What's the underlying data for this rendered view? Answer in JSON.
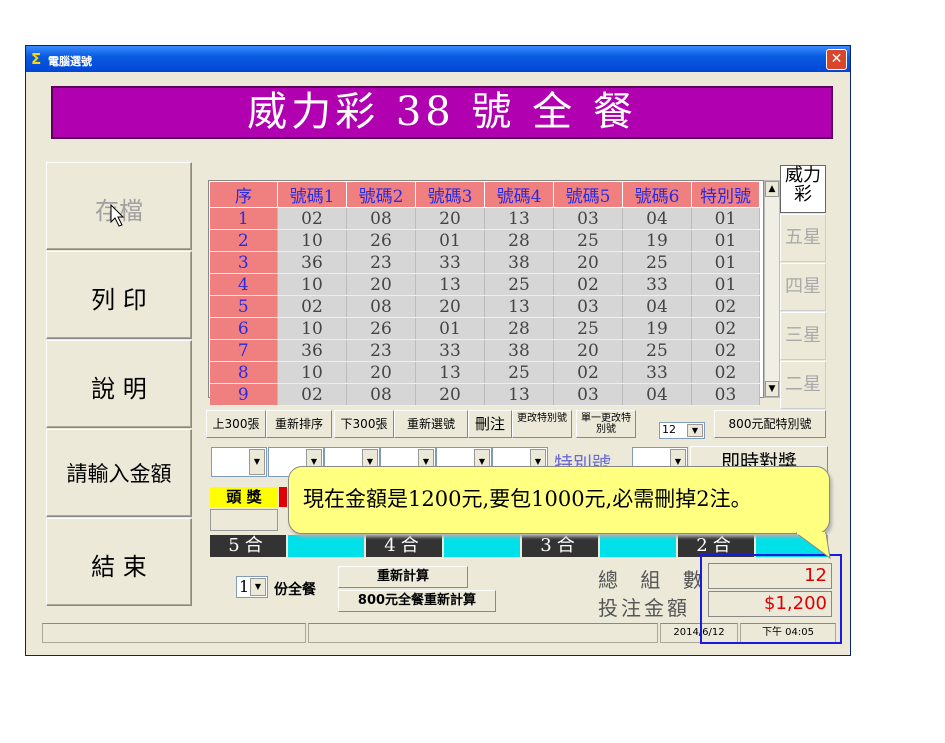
{
  "window": {
    "title": "電腦選號",
    "close": "✕"
  },
  "banner": "威力彩 38 號 全 餐",
  "sidebar": [
    "存檔",
    "列 印",
    "說 明",
    "請輸入金額",
    "結 束"
  ],
  "grid": {
    "headers": [
      "序",
      "號碼1",
      "號碼2",
      "號碼3",
      "號碼4",
      "號碼5",
      "號碼6",
      "特別號"
    ],
    "rows": [
      [
        "1",
        "02",
        "08",
        "20",
        "13",
        "03",
        "04",
        "01"
      ],
      [
        "2",
        "10",
        "26",
        "01",
        "28",
        "25",
        "19",
        "01"
      ],
      [
        "3",
        "36",
        "23",
        "33",
        "38",
        "20",
        "25",
        "01"
      ],
      [
        "4",
        "10",
        "20",
        "13",
        "25",
        "02",
        "33",
        "01"
      ],
      [
        "5",
        "02",
        "08",
        "20",
        "13",
        "03",
        "04",
        "02"
      ],
      [
        "6",
        "10",
        "26",
        "01",
        "28",
        "25",
        "19",
        "02"
      ],
      [
        "7",
        "36",
        "23",
        "33",
        "38",
        "20",
        "25",
        "02"
      ],
      [
        "8",
        "10",
        "20",
        "13",
        "25",
        "02",
        "33",
        "02"
      ],
      [
        "9",
        "02",
        "08",
        "20",
        "13",
        "03",
        "04",
        "03"
      ]
    ]
  },
  "tiers": [
    "威力彩",
    "五星",
    "四星",
    "三星",
    "二星"
  ],
  "toolbar": {
    "prev": "上300張",
    "resort": "重新排序",
    "next": "下300張",
    "reselect": "重新選號",
    "delete": "刪注",
    "change_special": "更改特別號",
    "change_one": "單一更改特別號",
    "count_value": "12",
    "special_800": "800元配特別號"
  },
  "check": {
    "special_label": "特別號",
    "instant": "即時對獎"
  },
  "prize_row": {
    "first": "頭 獎"
  },
  "match_labels": [
    "5合",
    "4合",
    "3合",
    "2合"
  ],
  "bottom": {
    "sets_value": "1",
    "sets_label": "份全餐",
    "recalc": "重新計算",
    "recalc_800": "800元全餐重新計算",
    "total_label": "總 組 數",
    "total_value": "12",
    "amount_label": "投注金額",
    "amount_value": "$1,200"
  },
  "status": {
    "date": "2014/6/12",
    "time": "下午 04:05"
  },
  "tooltip": "現在金額是1200元,要包1000元,必需刪掉2注。"
}
